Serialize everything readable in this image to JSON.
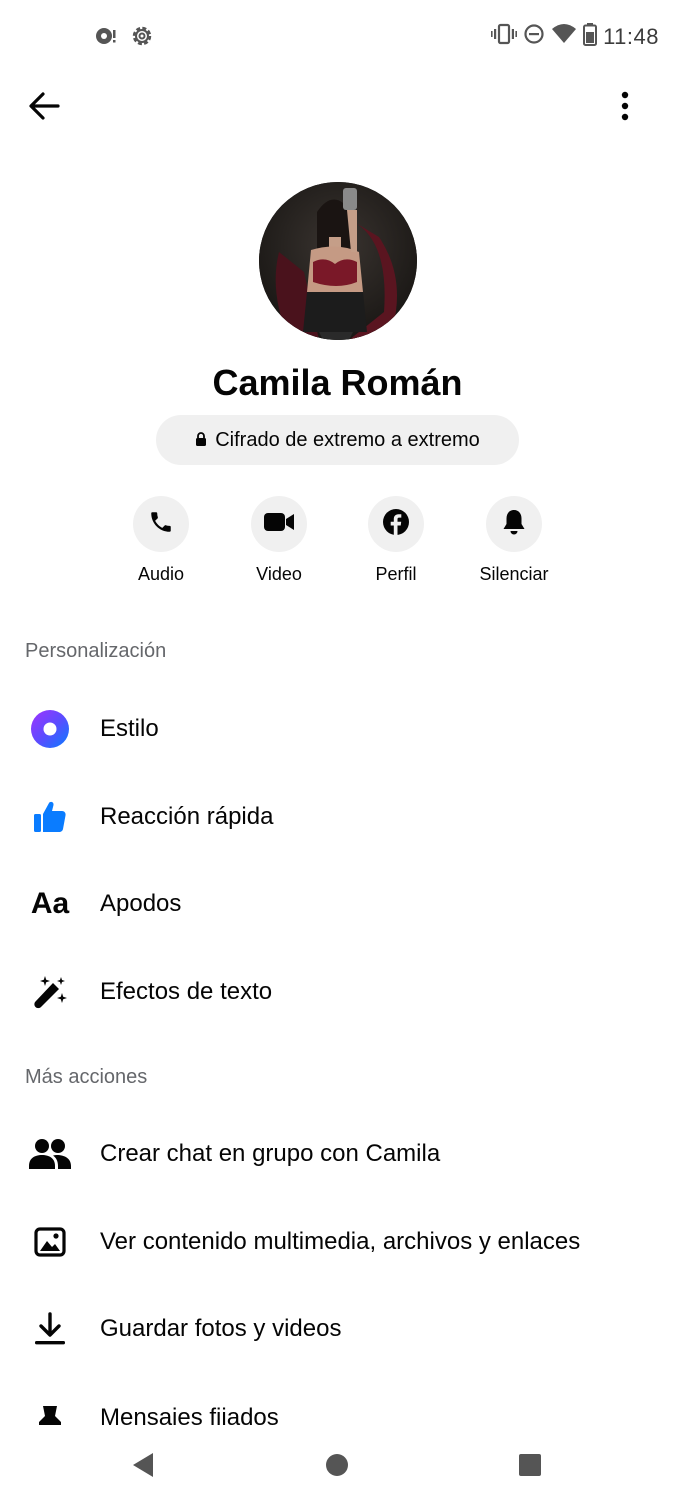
{
  "status_bar": {
    "time": "11:48",
    "left_icons": [
      "record-icon",
      "gear-icon"
    ],
    "right_icons": [
      "vibrate-icon",
      "do-not-disturb-icon",
      "wifi-icon",
      "battery-icon"
    ]
  },
  "top_bar": {
    "back_icon": "arrow-left-icon",
    "more_icon": "more-vertical-icon"
  },
  "profile": {
    "name": "Camila Román",
    "encryption_label": "Cifrado de extremo a extremo",
    "encryption_icon": "lock-icon"
  },
  "actions": [
    {
      "label": "Audio",
      "icon": "phone-icon"
    },
    {
      "label": "Video",
      "icon": "video-camera-icon"
    },
    {
      "label": "Perfil",
      "icon": "facebook-icon"
    },
    {
      "label": "Silenciar",
      "icon": "bell-icon"
    }
  ],
  "sections": {
    "personalization": {
      "title": "Personalización",
      "items": [
        {
          "label": "Estilo",
          "icon": "theme-circle-icon"
        },
        {
          "label": "Reacción rápida",
          "icon": "thumbs-up-icon"
        },
        {
          "label": "Apodos",
          "icon": "text-aa-icon"
        },
        {
          "label": "Efectos de texto",
          "icon": "magic-wand-icon"
        }
      ]
    },
    "more_actions": {
      "title": "Más acciones",
      "items": [
        {
          "label": "Crear chat en grupo con Camila",
          "icon": "group-people-icon"
        },
        {
          "label": "Ver contenido multimedia, archivos y enlaces",
          "icon": "image-icon"
        },
        {
          "label": "Guardar fotos y videos",
          "icon": "download-icon"
        },
        {
          "label": "Mensajes fijados",
          "icon": "pin-icon"
        }
      ]
    }
  },
  "colors": {
    "accent": "#0866ff",
    "secondary_text": "#65676b",
    "pill_background": "#f0f0f0"
  },
  "nav_bar": {
    "buttons": [
      "back-triangle-icon",
      "home-circle-icon",
      "recents-square-icon"
    ]
  }
}
